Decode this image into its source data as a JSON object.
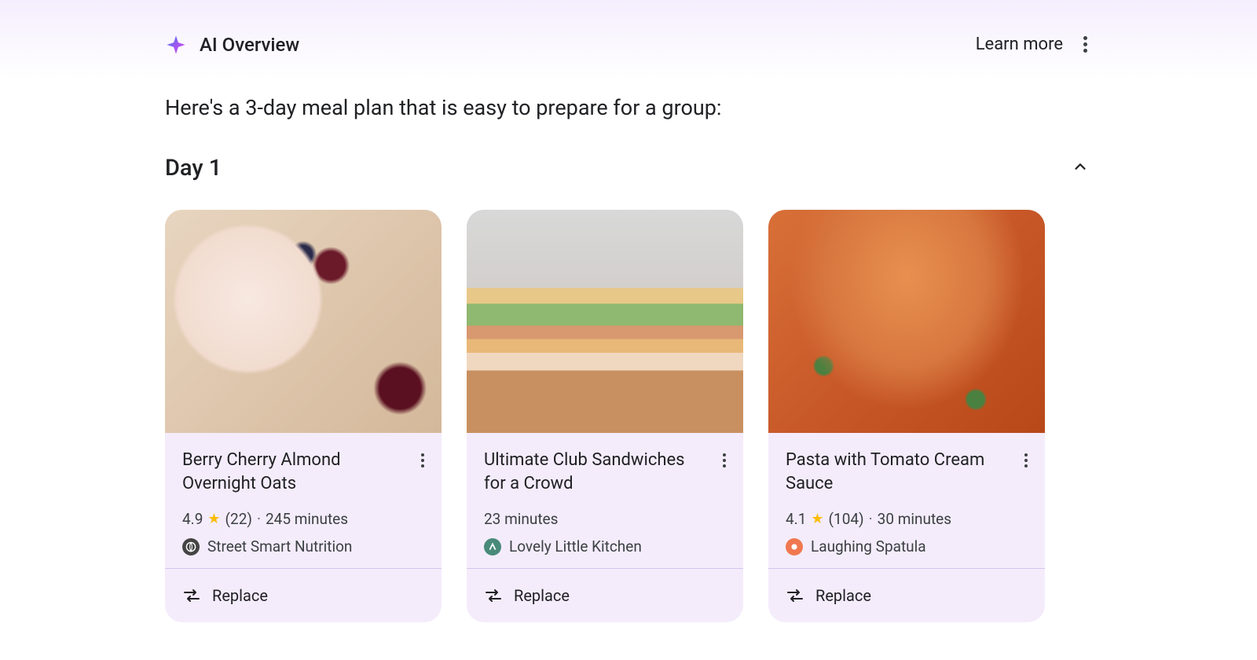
{
  "header": {
    "title": "AI Overview",
    "learn_more": "Learn more"
  },
  "intro_text": "Here's a 3-day meal plan that is easy to prepare for a group:",
  "day": {
    "label": "Day 1",
    "expanded": true
  },
  "cards": [
    {
      "title": "Berry Cherry Almond Overnight Oats",
      "rating": "4.9",
      "reviews": "(22)",
      "duration": "245 minutes",
      "source": "Street Smart Nutrition",
      "favicon_class": "fav-1",
      "replace_label": "Replace"
    },
    {
      "title": "Ultimate Club Sandwiches for a Crowd",
      "rating": null,
      "reviews": null,
      "duration": "23 minutes",
      "source": "Lovely Little Kitchen",
      "favicon_class": "fav-2",
      "replace_label": "Replace"
    },
    {
      "title": "Pasta with Tomato Cream Sauce",
      "rating": "4.1",
      "reviews": "(104)",
      "duration": "30 minutes",
      "source": "Laughing Spatula",
      "favicon_class": "fav-3",
      "replace_label": "Replace"
    }
  ]
}
